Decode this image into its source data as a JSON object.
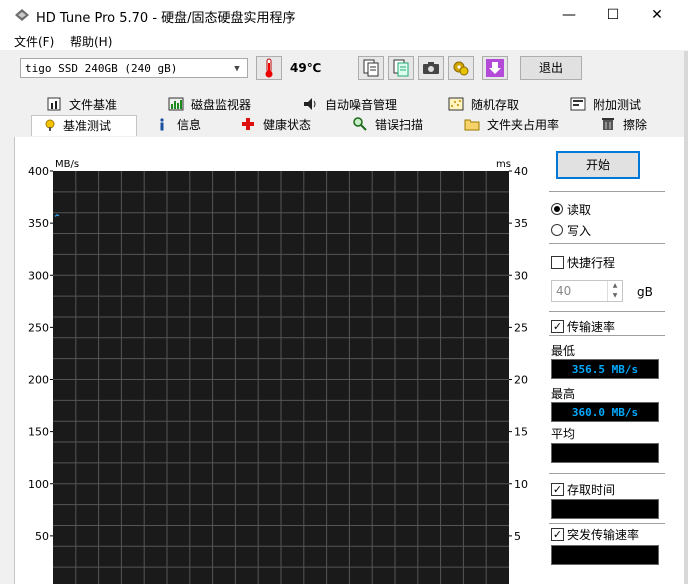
{
  "window": {
    "title": "HD Tune Pro 5.70 - 硬盘/固态硬盘实用程序",
    "controls": {
      "minimize": "—",
      "maximize": "☐",
      "close": "✕"
    }
  },
  "menu": {
    "file": "文件(F)",
    "help": "帮助(H)"
  },
  "toolbar": {
    "drive": "tigo SSD 240GB (240 gB)",
    "temperature": "49℃",
    "exit_label": "退出",
    "icons": [
      "thermometer-icon",
      "copy-info-icon",
      "copy-text-icon",
      "screenshot-icon",
      "options-icon",
      "save-icon"
    ]
  },
  "tabs_top": [
    {
      "label": "文件基准",
      "icon": "file-benchmark-icon"
    },
    {
      "label": "磁盘监视器",
      "icon": "disk-monitor-icon"
    },
    {
      "label": "自动噪音管理",
      "icon": "noise-management-icon"
    },
    {
      "label": "随机存取",
      "icon": "random-access-icon"
    },
    {
      "label": "附加测试",
      "icon": "extra-tests-icon"
    }
  ],
  "tabs_bottom": [
    {
      "label": "基准测试",
      "icon": "benchmark-icon",
      "selected": true
    },
    {
      "label": "信息",
      "icon": "info-icon"
    },
    {
      "label": "健康状态",
      "icon": "health-icon"
    },
    {
      "label": "错误扫描",
      "icon": "error-scan-icon"
    },
    {
      "label": "文件夹占用率",
      "icon": "folder-usage-icon"
    },
    {
      "label": "擦除",
      "icon": "erase-icon"
    }
  ],
  "panel": {
    "start_label": "开始",
    "read_label": "读取",
    "write_label": "写入",
    "short_stroke_label": "快捷行程",
    "short_stroke_value": "40",
    "short_stroke_unit": "gB",
    "transfer_rate_label": "传输速率",
    "min_label": "最低",
    "min_value": "356.5 MB/s",
    "max_label": "最高",
    "max_value": "360.0 MB/s",
    "avg_label": "平均",
    "avg_value": "",
    "access_time_label": "存取时间",
    "access_time_value": "",
    "burst_rate_label": "突发传输速率",
    "burst_rate_value": ""
  },
  "colors": {
    "chart_bg": "#1a1a1a",
    "grid": "#555555",
    "trace": "#33aaff",
    "accent": "#0078d7"
  },
  "chart_data": {
    "type": "line",
    "left_axis_label": "MB/s",
    "right_axis_label": "ms",
    "left_ylim": [
      0,
      400
    ],
    "right_ylim": [
      0,
      40
    ],
    "left_ticks": [
      400,
      350,
      300,
      250,
      200,
      150,
      100,
      50
    ],
    "right_ticks": [
      40,
      35,
      30,
      25,
      20,
      15,
      10,
      5
    ],
    "grid": true,
    "series": [
      {
        "values": [
          356.5,
          358.0,
          357.0
        ]
      }
    ]
  }
}
